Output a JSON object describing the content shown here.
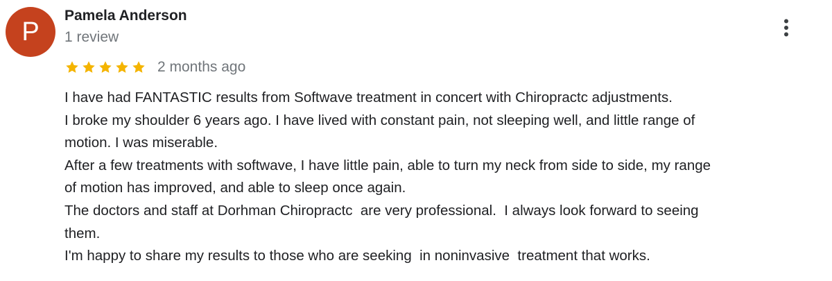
{
  "review": {
    "avatar_letter": "P",
    "avatar_color": "#c5421e",
    "reviewer_name": "Pamela Anderson",
    "review_count": "1 review",
    "rating": 5,
    "rating_max": 5,
    "star_color": "#f4b400",
    "date": "2 months ago",
    "more_icon": "more-vert-icon",
    "lines": [
      "I have had FANTASTIC results from Softwave treatment in concert with Chiropractc adjustments.",
      "I broke my shoulder 6 years ago. I have lived with constant pain, not sleeping well, and little range of",
      "motion. I was miserable.",
      "After a few treatments with softwave, I have little pain, able to turn my neck from side to side, my range",
      "of motion has improved, and able to sleep once again.",
      "The doctors and staff at Dorhman Chiropractc  are very professional.  I always look forward to seeing",
      "them.",
      "I'm happy to share my results to those who are seeking  in noninvasive  treatment that works."
    ]
  }
}
